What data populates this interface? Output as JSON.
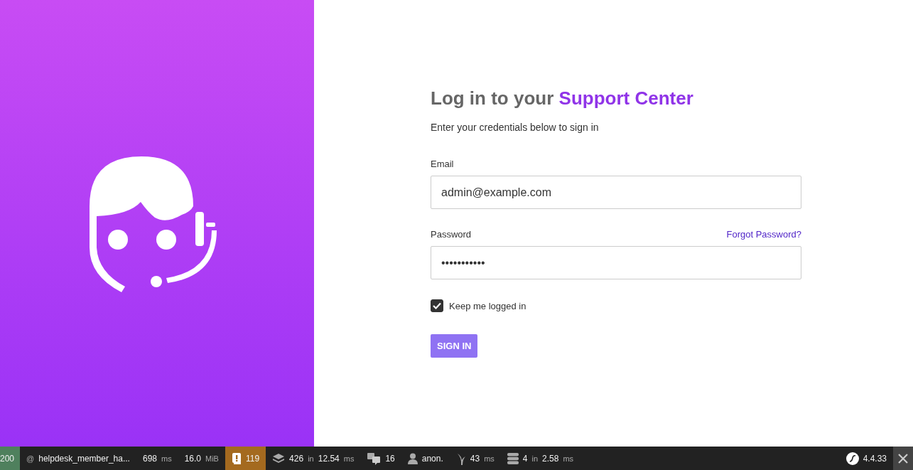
{
  "login": {
    "title": "Log in to your",
    "title_highlight": "Support Center",
    "subtitle": "Enter your credentials below to sign in",
    "email": {
      "label": "Email",
      "value": "admin@example.com"
    },
    "password": {
      "label": "Password",
      "value": "•••••••••••",
      "forgot_link": "Forgot Password?"
    },
    "remember": {
      "label": "Keep me logged in",
      "checked": true
    },
    "submit": "SIGN IN"
  },
  "toolbar": {
    "items": [
      {
        "kind": "status",
        "color": "#4f805d",
        "parts": [
          {
            "text": "200",
            "muted": false
          }
        ]
      },
      {
        "kind": "route",
        "parts": [
          {
            "text": "@",
            "muted": true
          },
          {
            "text": "helpdesk_member_ha...",
            "muted": false
          }
        ]
      },
      {
        "kind": "time",
        "parts": [
          {
            "text": "698",
            "muted": false
          },
          {
            "text": "ms",
            "muted": true
          }
        ]
      },
      {
        "kind": "memory",
        "parts": [
          {
            "text": "16.0",
            "muted": false
          },
          {
            "text": "MiB",
            "muted": true
          }
        ]
      },
      {
        "kind": "logs",
        "color": "#a46a1f",
        "parts": [
          {
            "text": "119",
            "muted": false
          }
        ]
      },
      {
        "kind": "database",
        "parts": [
          {
            "text": "426",
            "muted": false
          },
          {
            "text": "in",
            "muted": true
          },
          {
            "text": "12.54",
            "muted": false
          },
          {
            "text": "ms",
            "muted": true
          }
        ]
      },
      {
        "kind": "translation",
        "parts": [
          {
            "text": "16",
            "muted": false
          }
        ]
      },
      {
        "kind": "user",
        "parts": [
          {
            "text": "anon.",
            "muted": false
          }
        ]
      },
      {
        "kind": "twig",
        "parts": [
          {
            "text": "43",
            "muted": false
          },
          {
            "text": "ms",
            "muted": true
          }
        ]
      },
      {
        "kind": "cache",
        "parts": [
          {
            "text": "4",
            "muted": false
          },
          {
            "text": "in",
            "muted": true
          },
          {
            "text": "2.58",
            "muted": false
          },
          {
            "text": "ms",
            "muted": true
          }
        ]
      },
      {
        "kind": "version",
        "parts": [
          {
            "text": "4.4.33",
            "muted": false
          }
        ]
      }
    ]
  }
}
